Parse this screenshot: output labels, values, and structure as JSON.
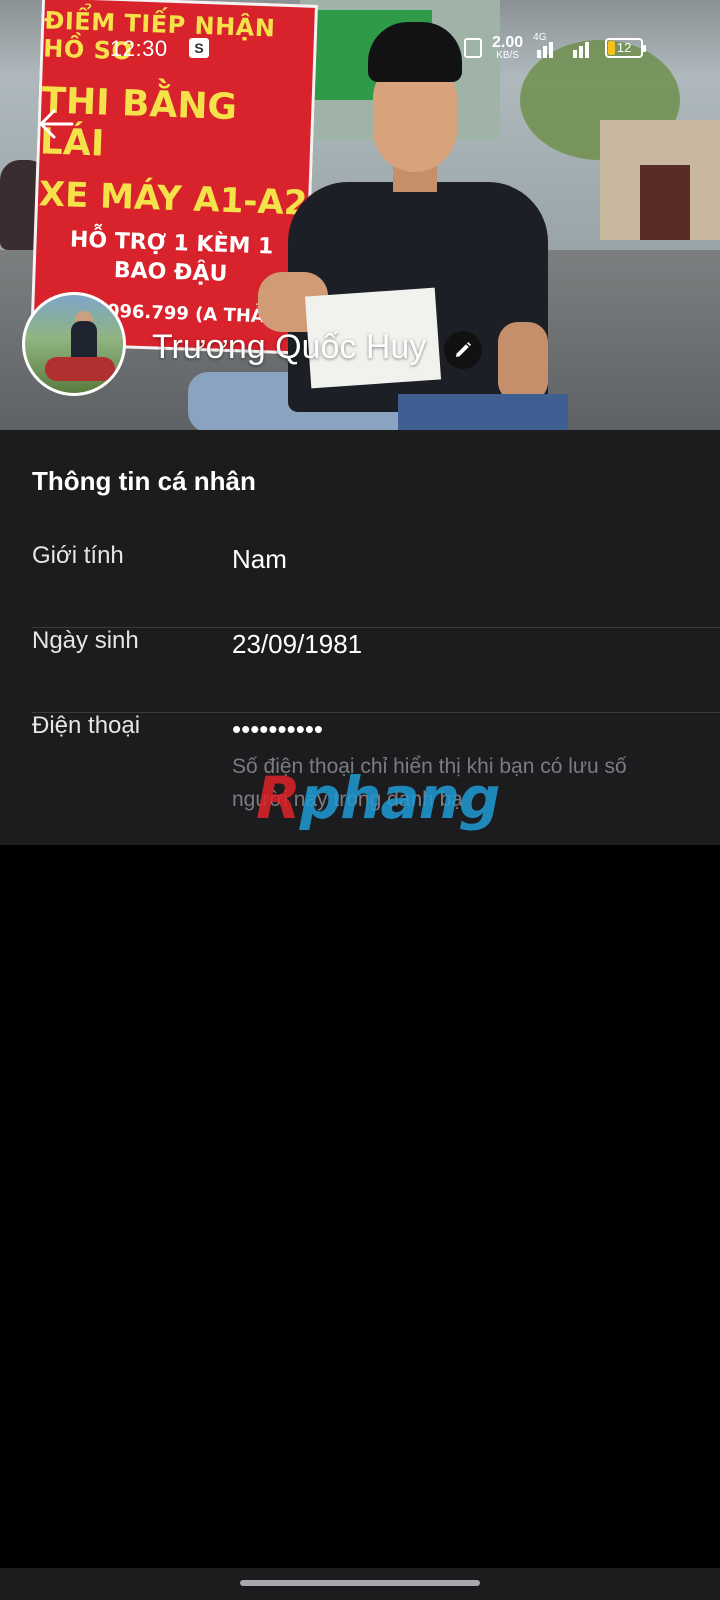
{
  "status_bar": {
    "time": "12:30",
    "shop_icon_glyph": "S",
    "speed_value": "2.00",
    "speed_unit": "KB/S",
    "network_type": "4G",
    "battery_level": "12",
    "icons": [
      "shopping-bag-icon",
      "vibrate-icon",
      "signal-icon",
      "battery-icon"
    ]
  },
  "cover_sign": {
    "line1": "ĐIỂM TIẾP NHẬN HỒ SƠ",
    "line2": "THI BẰNG LÁI",
    "line3": "XE MÁY A1-A2",
    "line4": "HỖ TRỢ 1 KÈM 1",
    "line5": "BAO ĐẬU",
    "line6": "0964.096.799 (A THẢO)"
  },
  "profile": {
    "name": "Trương Quốc Huy"
  },
  "info": {
    "section_title": "Thông tin cá nhân",
    "gender_label": "Giới tính",
    "gender_value": "Nam",
    "birthday_label": "Ngày sinh",
    "birthday_value": "23/09/1981",
    "phone_label": "Điện thoại",
    "phone_value": "••••••••••",
    "phone_note": "Số điện thoại chỉ hiển thị khi bạn có lưu số người này trong danh bạ"
  },
  "watermark": {
    "part1": "R",
    "part2": "phang"
  },
  "colors": {
    "panel_bg": "#1c1c1e",
    "page_bg": "#000000",
    "divider": "#3a3a3c",
    "note_text": "#7c7c80"
  }
}
